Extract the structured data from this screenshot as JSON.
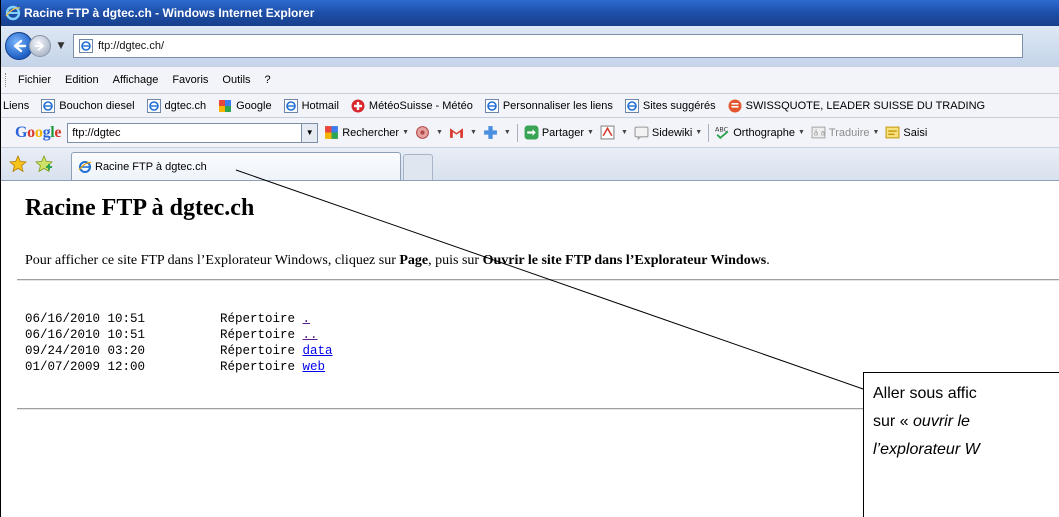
{
  "window": {
    "title": "Racine FTP à dgtec.ch - Windows Internet Explorer"
  },
  "address": {
    "url": "ftp://dgtec.ch/"
  },
  "menu": {
    "items": [
      "Fichier",
      "Edition",
      "Affichage",
      "Favoris",
      "Outils",
      "?"
    ]
  },
  "links": {
    "label": "Liens",
    "items": [
      "Bouchon diesel",
      "dgtec.ch",
      "Google",
      "Hotmail",
      "MétéoSuisse - Météo",
      "Personnaliser les liens",
      "Sites suggérés",
      "SWISSQUOTE, LEADER SUISSE DU TRADING"
    ]
  },
  "google_toolbar": {
    "logo": "Google",
    "search_value": "ftp://dgtec",
    "search_label": "Rechercher",
    "share_label": "Partager",
    "sidewiki_label": "Sidewiki",
    "spell_label": "Orthographe",
    "translate_label": "Traduire",
    "fill_label": "Saisi"
  },
  "tabs": {
    "active_label": "Racine FTP à dgtec.ch"
  },
  "page": {
    "title": "Racine FTP à dgtec.ch",
    "instr_prefix": "Pour afficher ce site FTP dans l’Explorateur Windows, cliquez sur ",
    "instr_page": "Page",
    "instr_middle": ", puis sur ",
    "instr_open": "Ouvrir le site FTP dans l’Explorateur Windows",
    "instr_suffix": ".",
    "listing": [
      {
        "date": "06/16/2010 10:51",
        "kind": "Répertoire ",
        "name": "."
      },
      {
        "date": "06/16/2010 10:51",
        "kind": "Répertoire ",
        "name": ".."
      },
      {
        "date": "09/24/2010 03:20",
        "kind": "Répertoire ",
        "name": "data"
      },
      {
        "date": "01/07/2009 12:00",
        "kind": "Répertoire ",
        "name": "web"
      }
    ]
  },
  "callout": {
    "line1": "Aller sous affic",
    "line2_prefix": "sur « ",
    "line2_italic": "ouvrir le",
    "line3": "l’explorateur W"
  },
  "colors": {
    "title_bar": "#1e4fa8",
    "link": "#0000ee",
    "visited_link": "#551a8b"
  }
}
